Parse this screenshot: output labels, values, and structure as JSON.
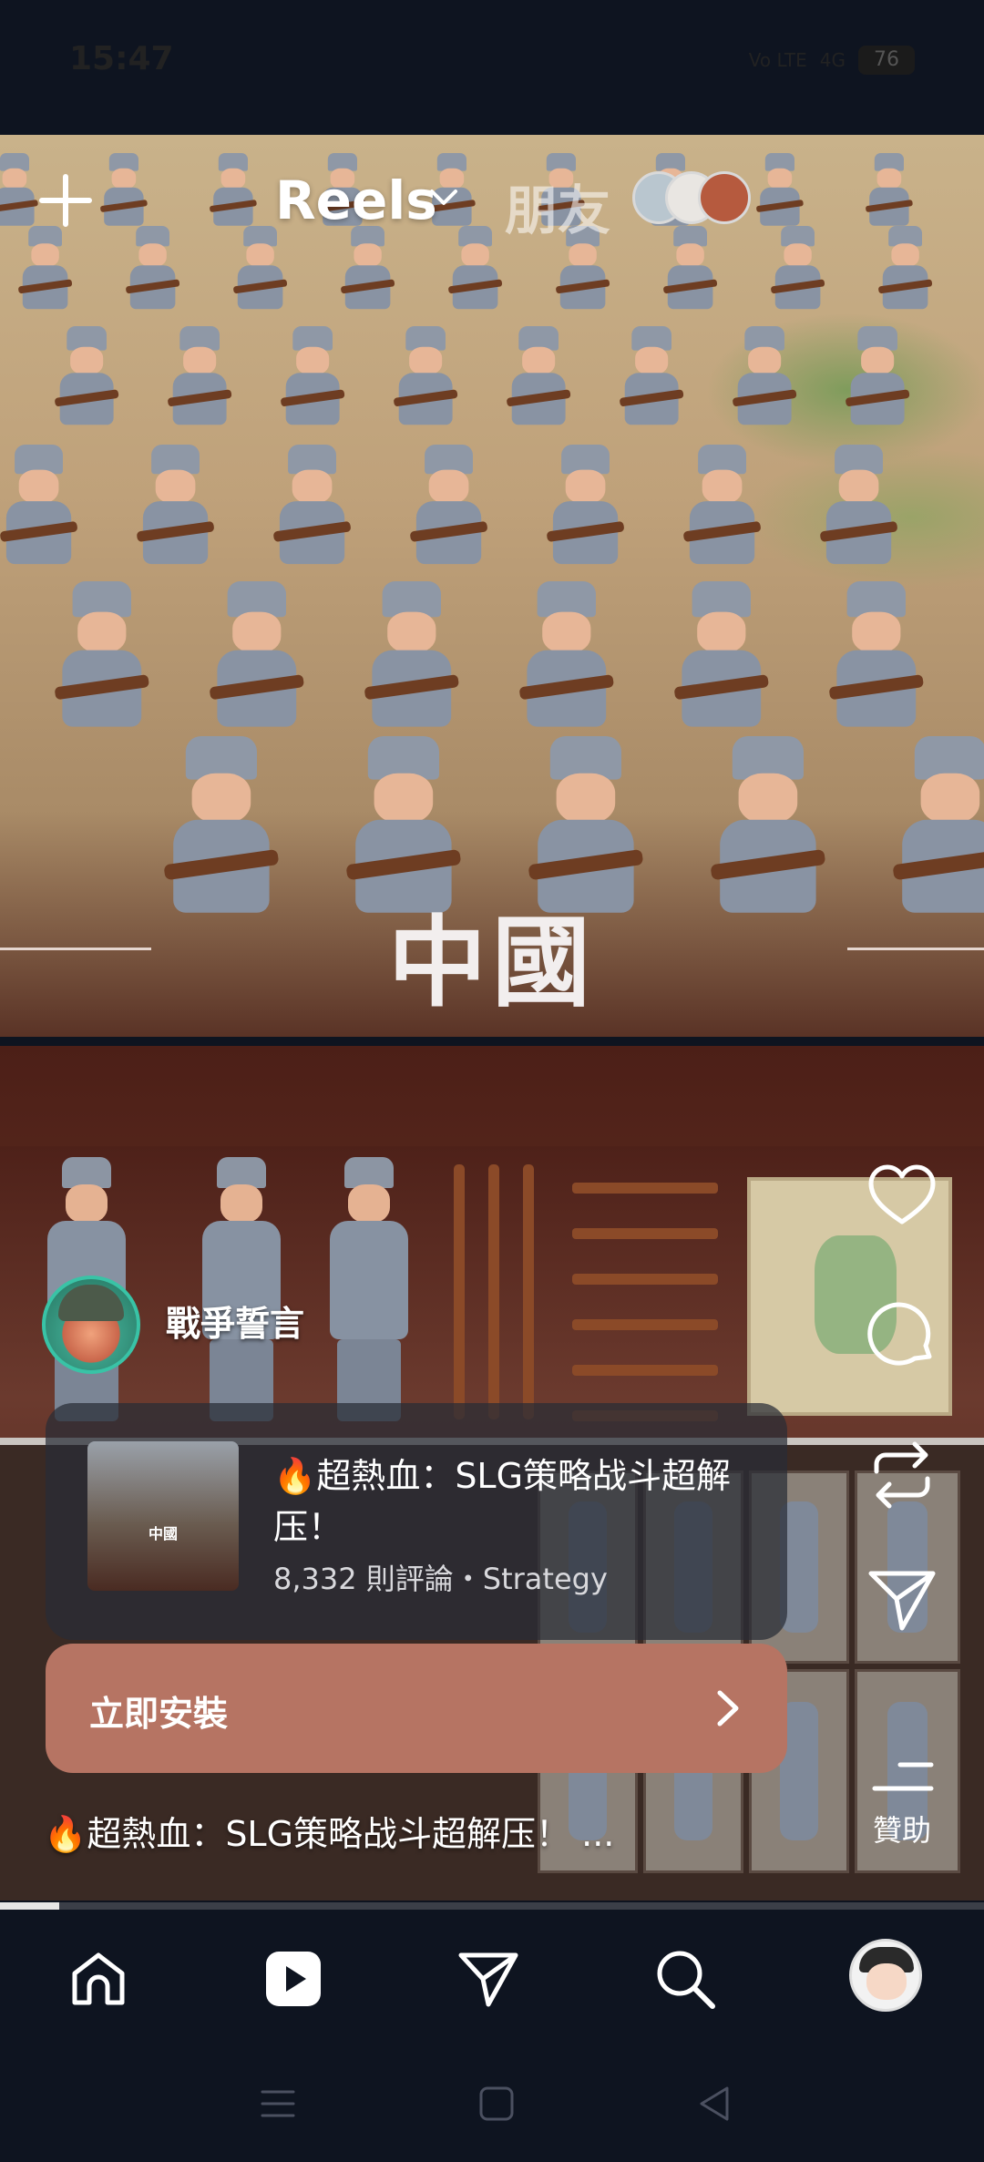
{
  "status_bar": {
    "time": "15:47",
    "network": "Vo LTE",
    "signal": "4G",
    "battery": "76"
  },
  "header": {
    "title": "Reels",
    "friends_tab": "朋友"
  },
  "video": {
    "overlay_title": "中國",
    "author_name": "戰爭誓言"
  },
  "ad": {
    "title": "🔥超熱血：SLG策略战斗超解压！",
    "meta": "8,332 則評論・Strategy",
    "install_label": "立即安裝",
    "caption": "🔥超熱血：SLG策略战斗超解压！ ...",
    "thumb_title": "中國",
    "progress": 0.06
  },
  "actions": {
    "sponsored_label": "贊助"
  },
  "icons": {
    "like": "heart-icon",
    "comment": "comment-icon",
    "repost": "repost-icon",
    "share": "send-icon",
    "more": "menu-icon"
  },
  "colors": {
    "background": "#0e1420",
    "install_button": "#b67463",
    "ad_card": "#282c36"
  }
}
